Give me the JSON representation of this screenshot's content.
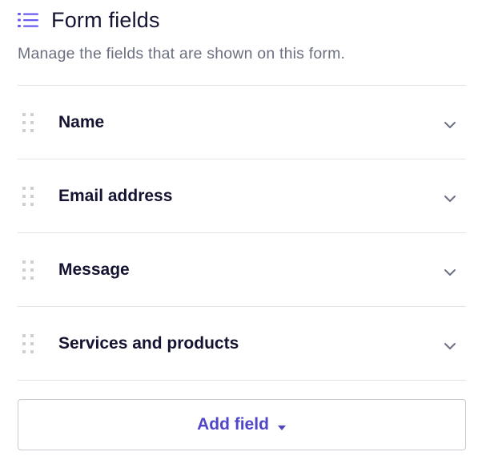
{
  "header": {
    "icon": "list-icon",
    "title": "Form fields",
    "subtitle": "Manage the fields that are shown on this form."
  },
  "fields": [
    {
      "label": "Name",
      "drag_icon": "drag-handle-icon",
      "expand_icon": "chevron-down-icon"
    },
    {
      "label": "Email address",
      "drag_icon": "drag-handle-icon",
      "expand_icon": "chevron-down-icon"
    },
    {
      "label": "Message",
      "drag_icon": "drag-handle-icon",
      "expand_icon": "chevron-down-icon"
    },
    {
      "label": "Services and products",
      "drag_icon": "drag-handle-icon",
      "expand_icon": "chevron-down-icon"
    }
  ],
  "add_field": {
    "label": "Add field",
    "icon": "caret-down-icon"
  },
  "colors": {
    "accent": "#4f46c8",
    "icon_accent": "#6a5cf0",
    "text": "#141432",
    "muted": "#6b6f80",
    "divider": "#e2e3e8"
  }
}
